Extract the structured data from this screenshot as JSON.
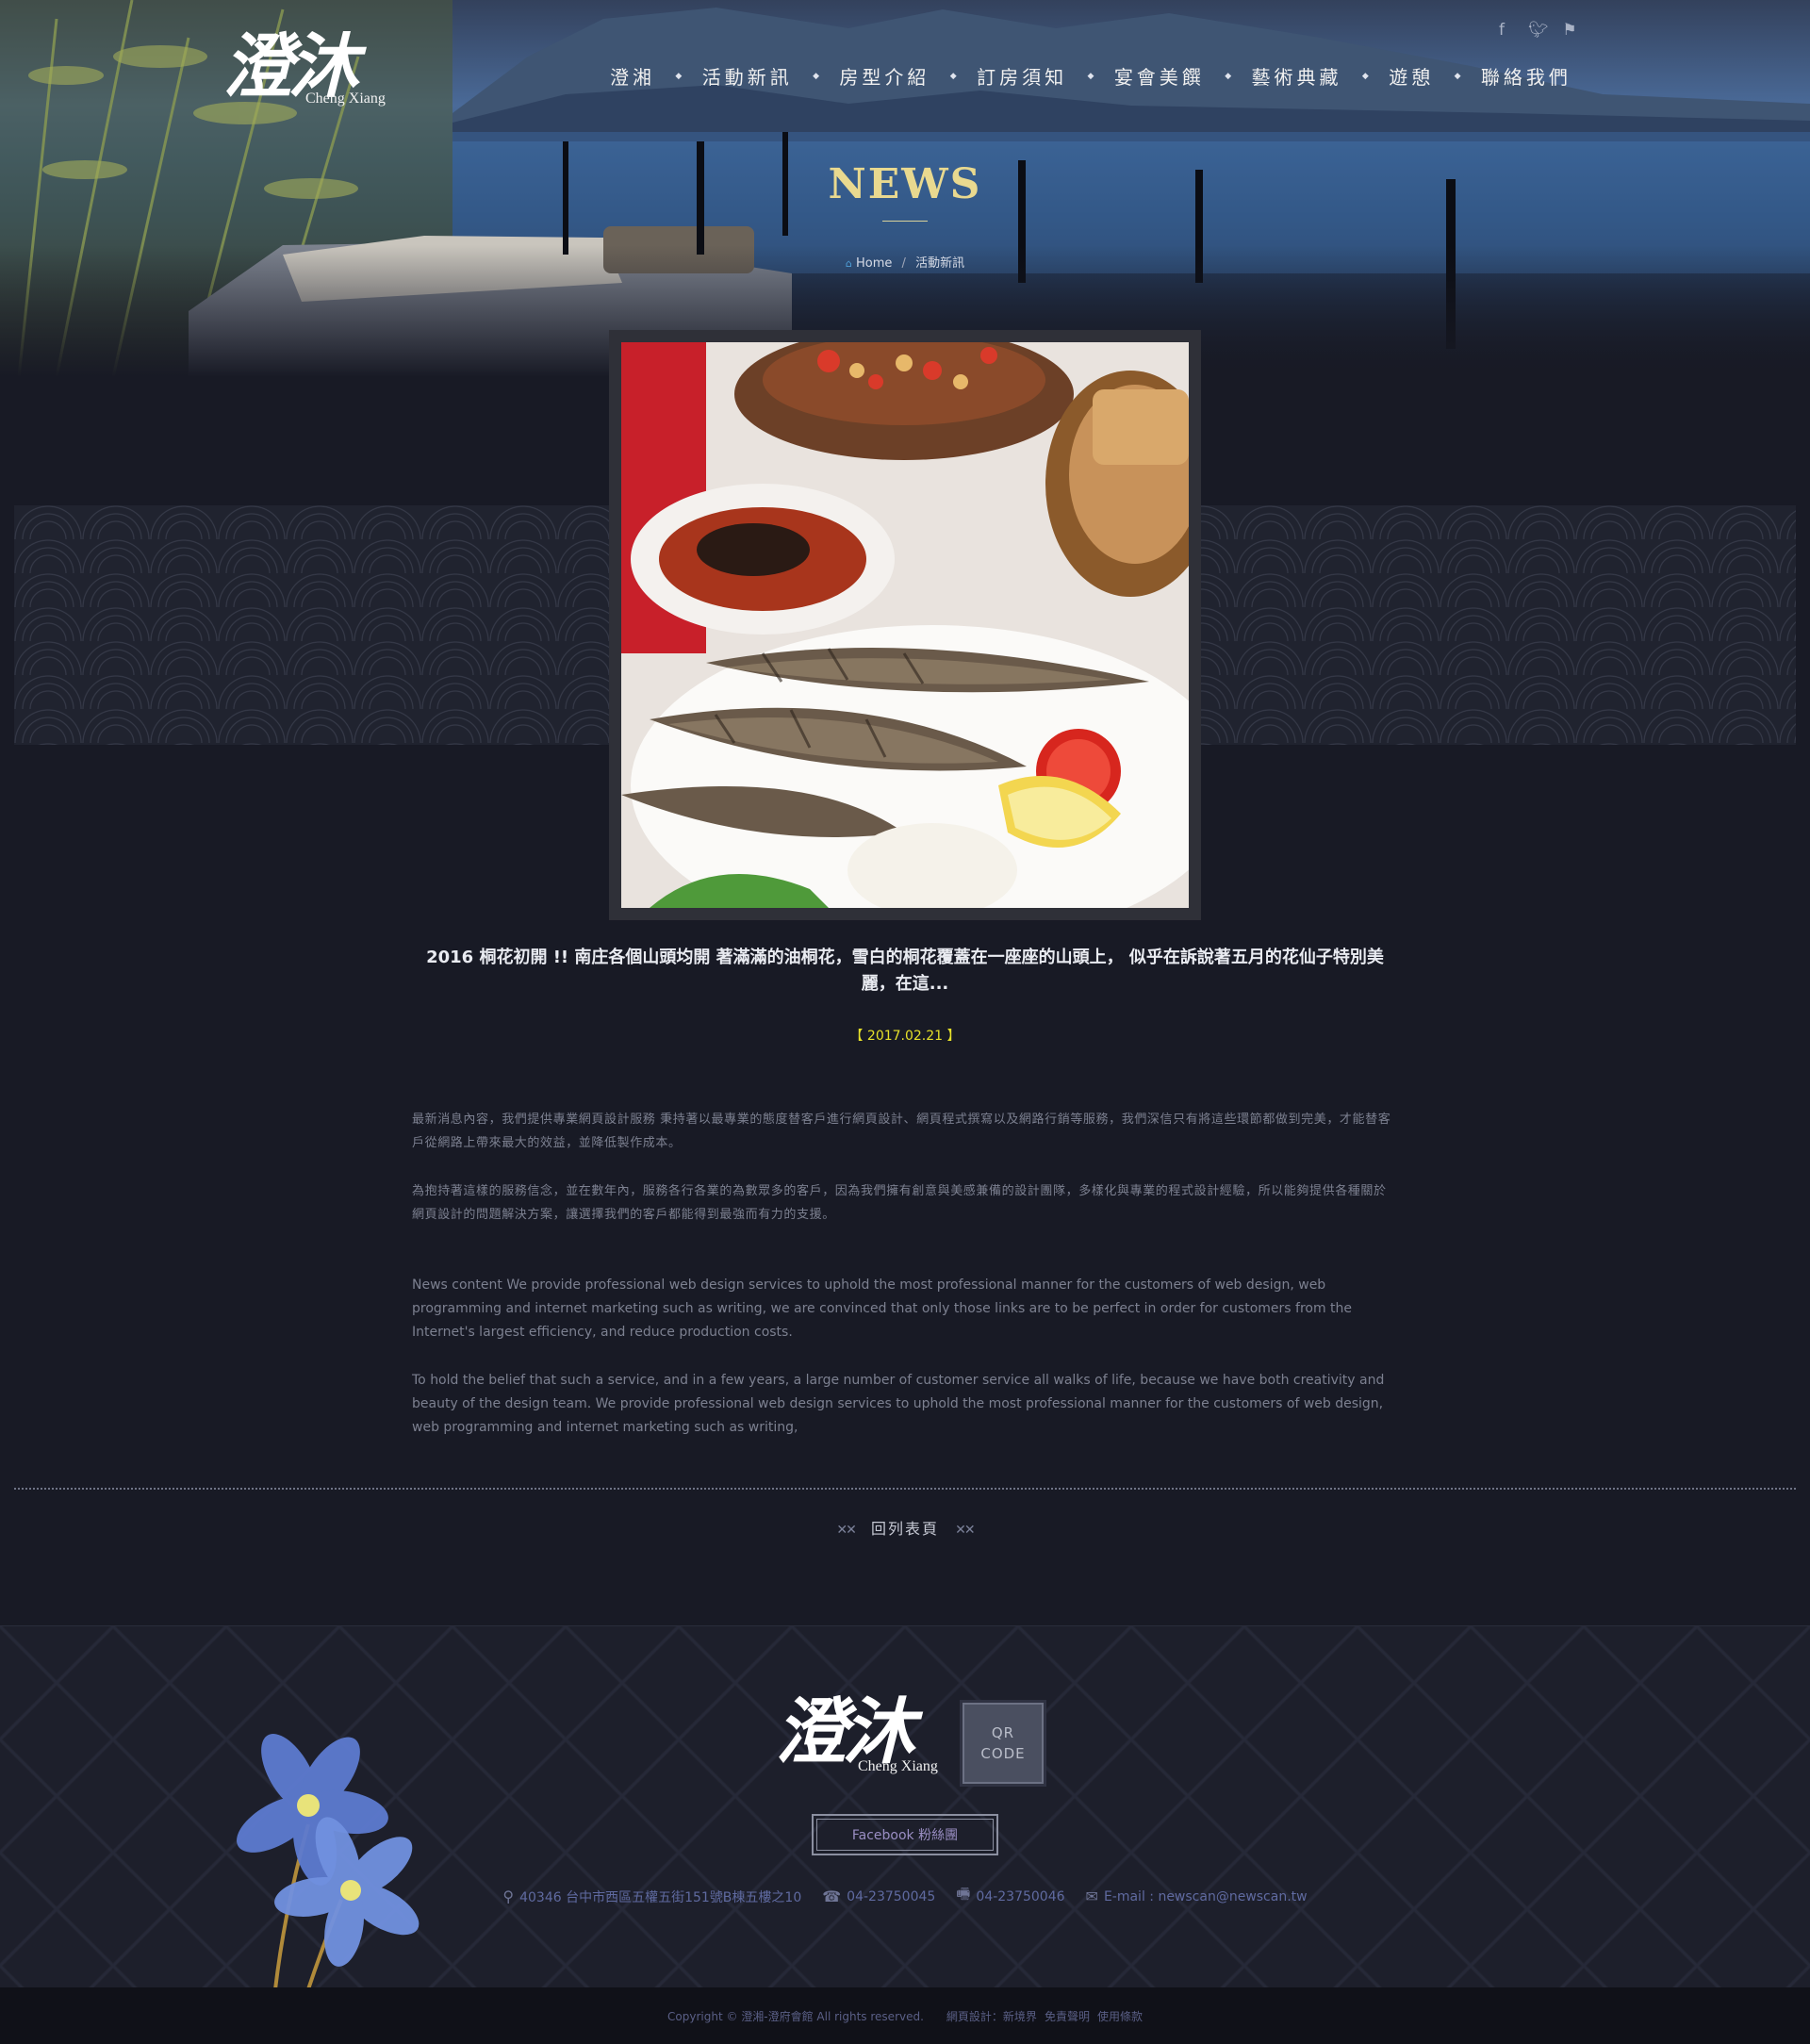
{
  "header": {
    "logo_text": "澄沐",
    "logo_sub": "Cheng Xiang",
    "social_icons": [
      "facebook-icon",
      "twitter-icon",
      "flag-icon"
    ],
    "nav": [
      {
        "label": "澄湘"
      },
      {
        "label": "活動新訊"
      },
      {
        "label": "房型介紹"
      },
      {
        "label": "訂房須知"
      },
      {
        "label": "宴會美饌"
      },
      {
        "label": "藝術典藏"
      },
      {
        "label": "遊憩"
      },
      {
        "label": "聯絡我們"
      }
    ],
    "page_title": "NEWS",
    "breadcrumb": {
      "home": "Home",
      "separator": "/",
      "current": "活動新訊"
    }
  },
  "article": {
    "headline": "2016 桐花初開 !! 南庄各個山頭均開 著滿滿的油桐花，雪白的桐花覆蓋在一座座的山頭上， 似乎在訴說著五月的花仙子特別美麗，在這...",
    "date": "【 2017.02.21 】",
    "paragraphs": [
      "最新消息內容，我們提供專業網頁設計服務 秉持著以最專業的態度替客戶進行網頁設計、網頁程式撰寫以及網路行銷等服務，我們深信只有將這些環節都做到完美，才能替客戶從網路上帶來最大的效益，並降低製作成本。",
      "為抱持著這樣的服務信念，並在數年內，服務各行各業的為數眾多的客戶，因為我們擁有創意與美感兼備的設計團隊，多樣化與專業的程式設計經驗，所以能夠提供各種關於網頁設計的問題解決方案，讓選擇我們的客戶都能得到最強而有力的支援。",
      "News content We provide professional web design services to uphold the most professional manner for the customers of web design, web programming and internet marketing such as writing, we are convinced that only those links are to be perfect in order for customers from the Internet's largest efficiency, and reduce production costs.",
      "To hold the belief that such a service, and in a few years, a large number of customer service all walks of life, because we have both creativity and beauty of the design team. We provide professional web design services to uphold the most professional manner for the customers of web design, web programming and internet marketing such as writing,"
    ],
    "back_label": "回列表頁",
    "back_deco": "✕✕"
  },
  "footer": {
    "logo_text": "澄沐",
    "logo_sub": "Cheng Xiang",
    "qr_line1": "QR",
    "qr_line2": "CODE",
    "facebook_label": "Facebook 粉絲團",
    "address": "40346 台中市西區五權五街151號B棟五樓之10",
    "phone": "04-23750045",
    "fax": "04-23750046",
    "email": "E-mail : newscan@newscan.tw",
    "copyright": "Copyright © 澄湘-澄府會館 All rights reserved.",
    "links": [
      "網頁設計：新境界",
      "免責聲明",
      "使用條款"
    ]
  },
  "colors": {
    "page_bg": "#181a25",
    "title_gold": "#e9d98f",
    "date_yellow": "#e6e02a",
    "footer_bg": "#1d1f2b",
    "copyright_bg": "#101118"
  }
}
